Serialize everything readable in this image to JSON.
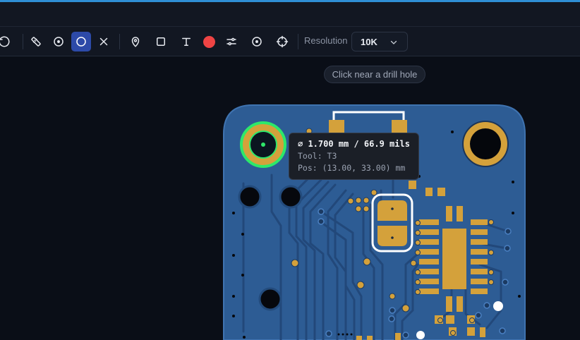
{
  "toolbar": {
    "tools": [
      {
        "name": "undo-icon",
        "active": false
      },
      {
        "name": "ruler-icon",
        "active": false
      },
      {
        "name": "point-icon",
        "active": false
      },
      {
        "name": "circle-icon",
        "active": true
      },
      {
        "name": "close-icon",
        "active": false
      },
      {
        "name": "pin-icon",
        "active": false
      },
      {
        "name": "square-icon",
        "active": false
      },
      {
        "name": "text-icon",
        "active": false
      },
      {
        "name": "color-swatch",
        "active": false
      },
      {
        "name": "sliders-icon",
        "active": false
      },
      {
        "name": "target-icon",
        "active": false
      },
      {
        "name": "crosshair-icon",
        "active": false
      }
    ],
    "color_swatch": "#ef4444",
    "resolution_label": "Resolution",
    "resolution_value": "10K"
  },
  "hint": "Click near a drill hole",
  "tooltip": {
    "diameter": "⌀ 1.700 mm / 66.9 mils",
    "tool": "Tool: T3",
    "position": "Pos: (13.00, 33.00) mm"
  },
  "colors": {
    "accent": "#2f8fd6",
    "active_tool": "#2d4aa8",
    "board": "#2d5c94",
    "copper": "#d4a13b",
    "selection": "#2ee86a"
  }
}
